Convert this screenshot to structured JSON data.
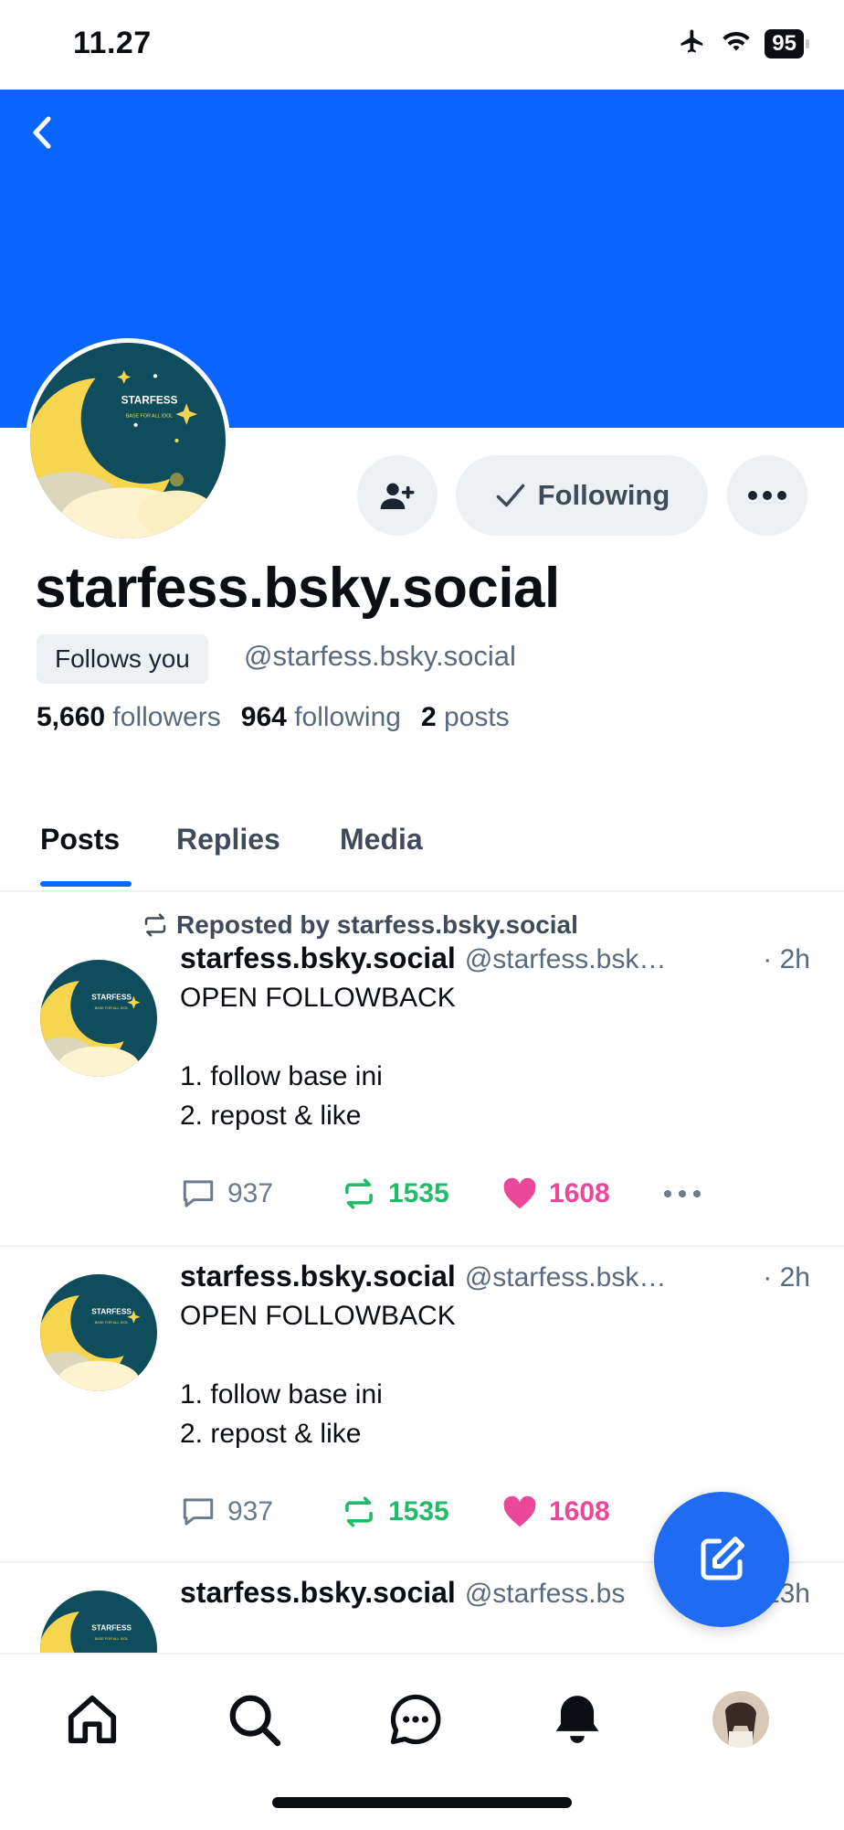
{
  "status_bar": {
    "time": "11.27",
    "battery": "95"
  },
  "profile": {
    "display_name": "starfess.bsky.social",
    "follows_you": "Follows you",
    "handle": "@starfess.bsky.social",
    "followers_count": "5,660",
    "followers_label": "followers",
    "following_count": "964",
    "following_label": "following",
    "posts_count": "2",
    "posts_label": "posts",
    "following_button": "Following",
    "avatar_text": "STARFESS",
    "avatar_subtext": "BASE FOR ALL IDOL"
  },
  "tabs": [
    {
      "label": "Posts",
      "active": true
    },
    {
      "label": "Replies",
      "active": false
    },
    {
      "label": "Media",
      "active": false
    }
  ],
  "posts": [
    {
      "repost_line": "Reposted by starfess.bsky.social",
      "author": "starfess.bsky.social",
      "handle": "@starfess.bsk…",
      "time": "· 2h",
      "text": "OPEN FOLLOWBACK\n\n1. follow base ini\n2. repost & like",
      "replies": "937",
      "reposts": "1535",
      "likes": "1608"
    },
    {
      "author": "starfess.bsky.social",
      "handle": "@starfess.bsk…",
      "time": "· 2h",
      "text": "OPEN FOLLOWBACK\n\n1. follow base ini\n2. repost & like",
      "replies": "937",
      "reposts": "1535",
      "likes": "1608"
    },
    {
      "author": "starfess.bsky.social",
      "handle": "@starfess.bs",
      "time": "23h"
    }
  ],
  "colors": {
    "banner": "#0866ff",
    "accent": "#0866ff",
    "repost": "#20bc6a",
    "like": "#ec4899",
    "fab": "#1f6bf2"
  },
  "icons": {
    "nav": [
      "home-icon",
      "search-icon",
      "chat-icon",
      "bell-icon",
      "profile-avatar"
    ]
  }
}
